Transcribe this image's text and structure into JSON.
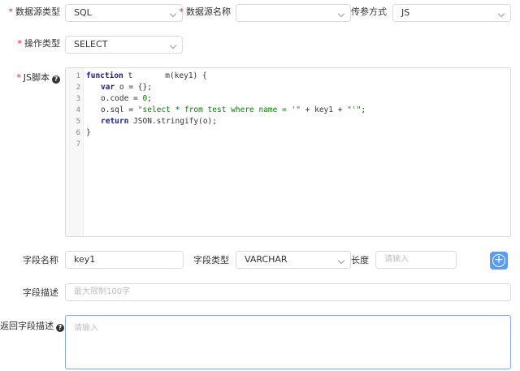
{
  "row1": {
    "datasource_type_label": "数据源类型",
    "datasource_type_value": "SQL",
    "datasource_name_label": "数据源名称",
    "datasource_name_value": "",
    "param_method_label": "传参方式",
    "param_method_value": "JS"
  },
  "row2": {
    "op_type_label": "操作类型",
    "op_type_value": "SELECT"
  },
  "script": {
    "label": "JS脚本",
    "lines": [
      {
        "no": "1"
      },
      {
        "no": "2"
      },
      {
        "no": "3"
      },
      {
        "no": "4"
      },
      {
        "no": "5"
      },
      {
        "no": "6"
      },
      {
        "no": "7"
      }
    ],
    "code": {
      "l1_kw": "function",
      "l1_rest": " t       m(key1) {",
      "l2_kw": "var",
      "l2_rest": " o = {};",
      "l3_pre": "o.code = ",
      "l3_num": "0",
      "l3_post": ";",
      "l4_pre": "o.sql = ",
      "l4_str": "\"select * from test where name = '\"",
      "l4_mid": " + key1 + ",
      "l4_str2": "\"'\"",
      "l4_post": ";",
      "l5_kw": "return",
      "l5_rest": " JSON.stringify(o);",
      "l6": "}"
    }
  },
  "field": {
    "name_label": "字段名称",
    "name_value": "key1",
    "type_label": "字段类型",
    "type_value": "VARCHAR",
    "length_label": "长度",
    "length_placeholder": "请输入",
    "desc_label": "字段描述",
    "desc_placeholder": "最大限制100字"
  },
  "return_desc": {
    "label": "返回字段描述",
    "placeholder": "请输入"
  },
  "icons": {
    "help": "?",
    "plus": "+"
  }
}
